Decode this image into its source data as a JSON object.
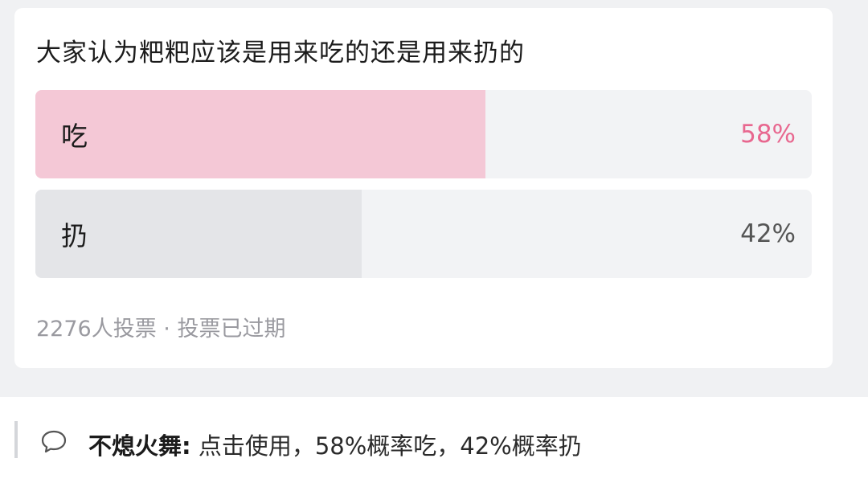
{
  "poll": {
    "title": "大家认为粑粑应该是用来吃的还是用来扔的",
    "options": [
      {
        "label": "吃",
        "percent_text": "58%",
        "percent": 58,
        "fill_color": "#f4c8d6",
        "percent_color": "#e8678f"
      },
      {
        "label": "扔",
        "percent_text": "42%",
        "percent": 42,
        "fill_color": "#e4e5e8",
        "percent_color": "#555555"
      }
    ],
    "meta": "2276人投票 · 投票已过期"
  },
  "comment": {
    "icon": "comment-bubble-icon",
    "author": "不熄火舞:",
    "text": " 点击使用，58%概率吃，42%概率扔"
  }
}
